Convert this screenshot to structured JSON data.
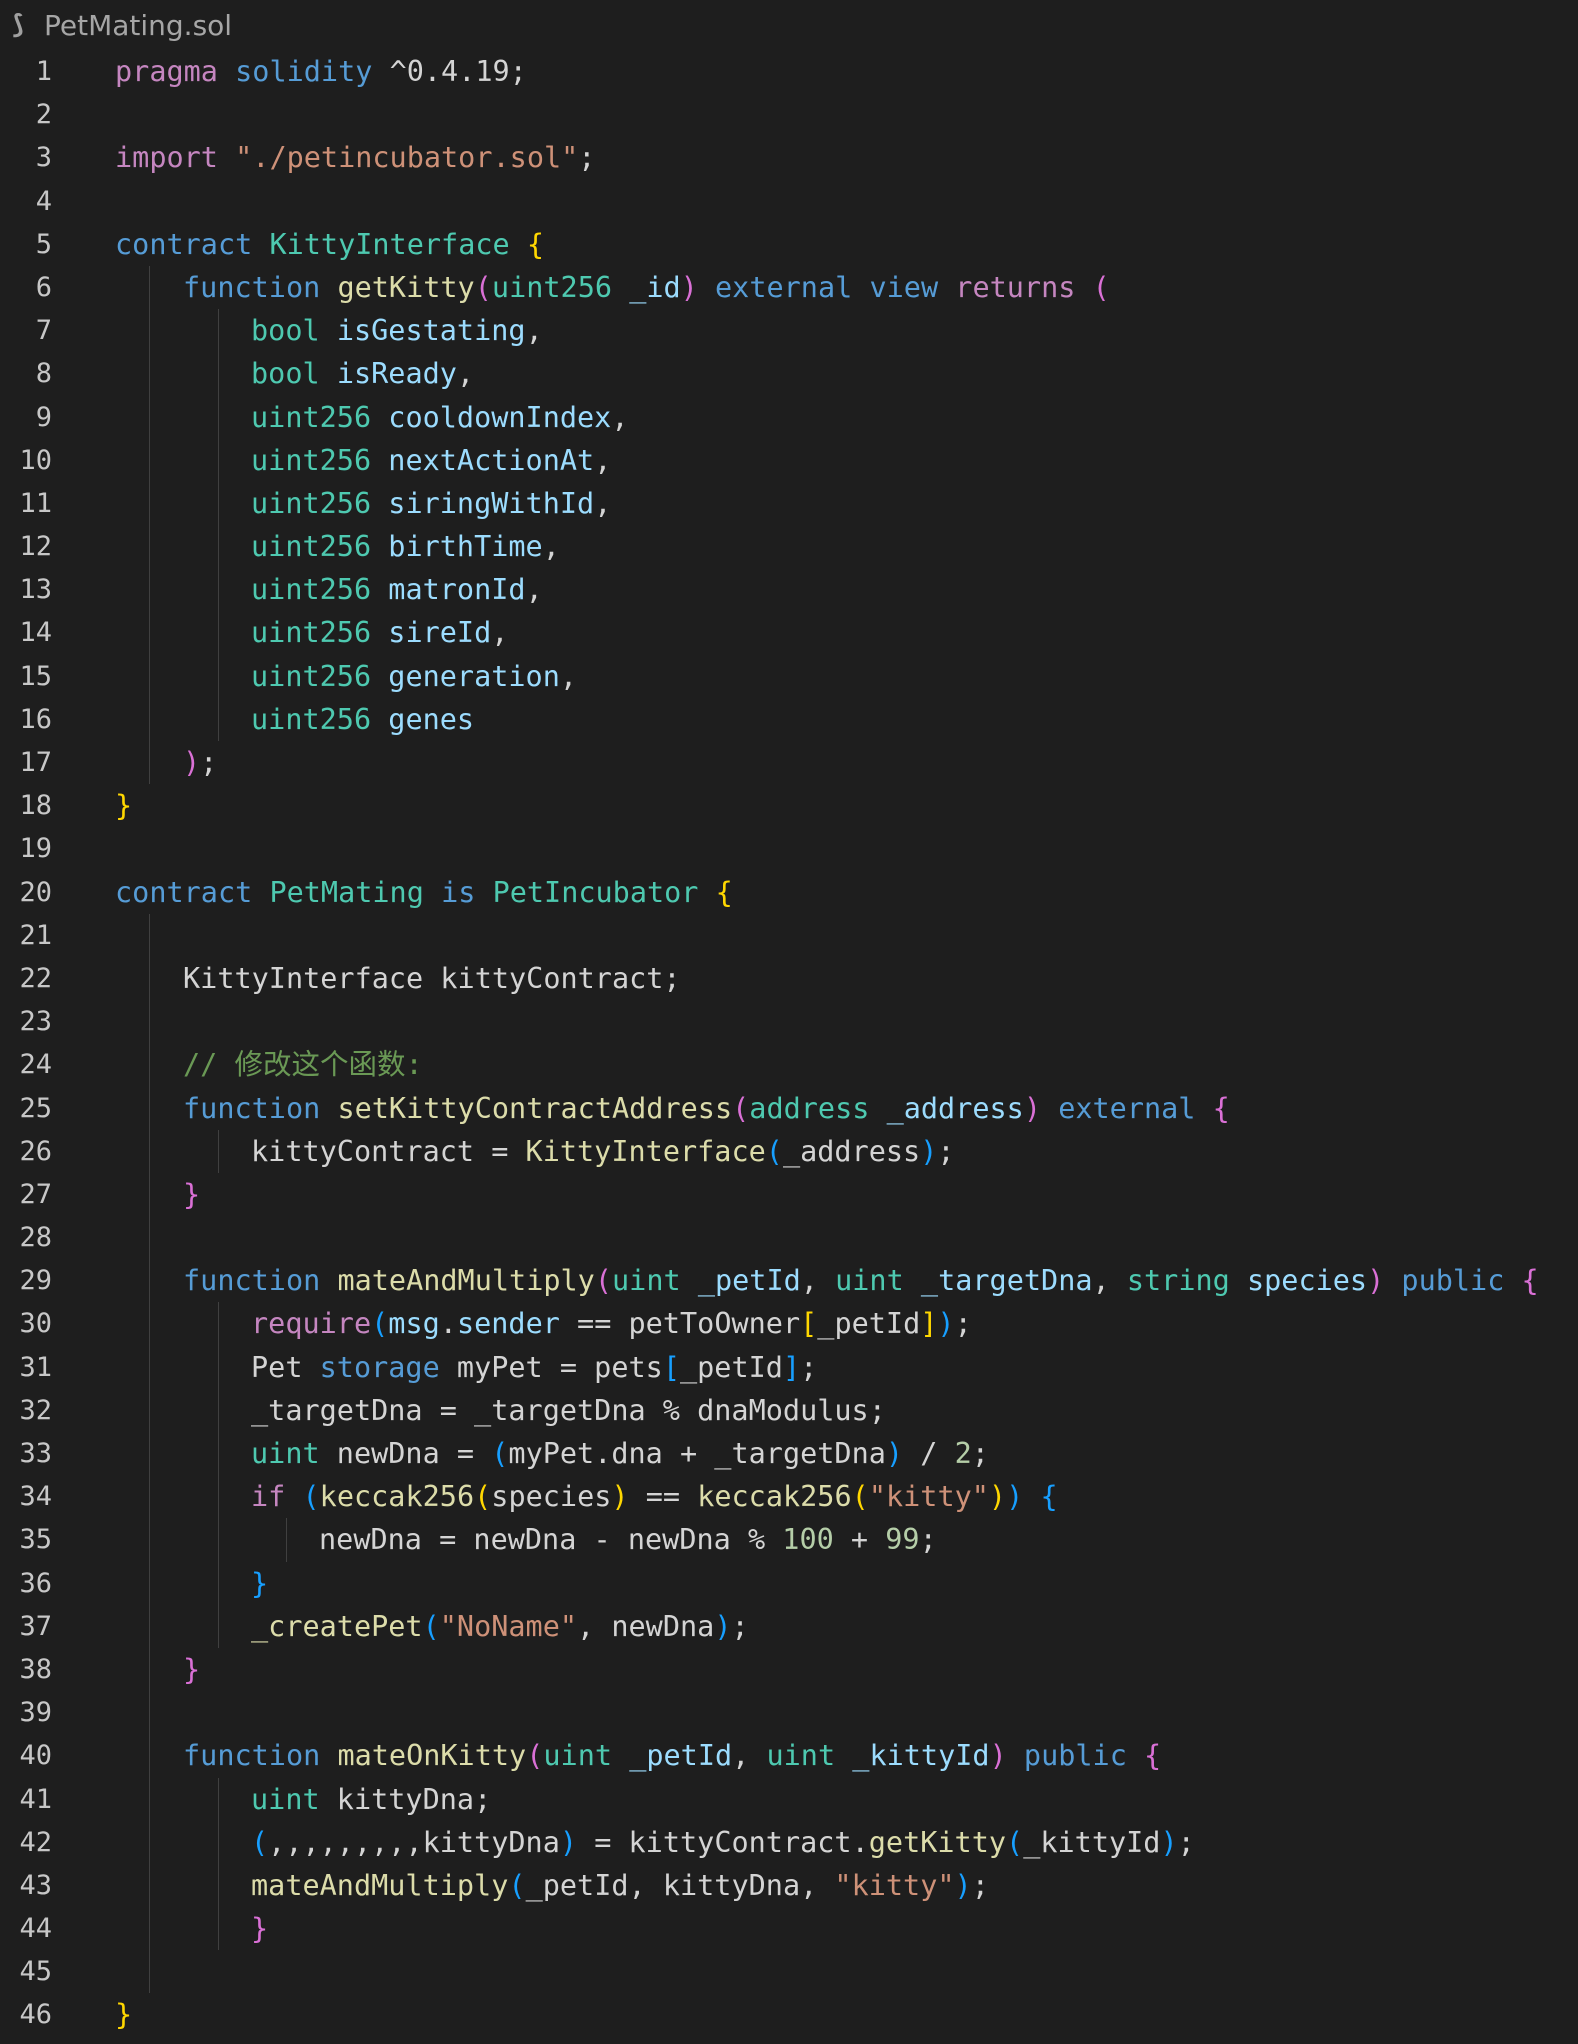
{
  "tab": {
    "title": "PetMating.sol",
    "icon": "solidity-file-icon"
  },
  "lines": [
    {
      "n": "1",
      "indent": 0,
      "tokens": [
        [
          "ctl",
          "pragma"
        ],
        [
          "pl",
          " "
        ],
        [
          "kw",
          "solidity"
        ],
        [
          "pl",
          " ^0.4.19;"
        ]
      ]
    },
    {
      "n": "2",
      "indent": 0,
      "tokens": []
    },
    {
      "n": "3",
      "indent": 0,
      "tokens": [
        [
          "ctl",
          "import"
        ],
        [
          "pl",
          " "
        ],
        [
          "str",
          "\"./petincubator.sol\""
        ],
        [
          "pl",
          ";"
        ]
      ]
    },
    {
      "n": "4",
      "indent": 0,
      "tokens": []
    },
    {
      "n": "5",
      "indent": 0,
      "tokens": [
        [
          "kw",
          "contract"
        ],
        [
          "pl",
          " "
        ],
        [
          "ty",
          "KittyInterface"
        ],
        [
          "pl",
          " "
        ],
        [
          "b1",
          "{"
        ]
      ]
    },
    {
      "n": "6",
      "indent": 1,
      "tokens": [
        [
          "kw",
          "function"
        ],
        [
          "pl",
          " "
        ],
        [
          "fn",
          "getKitty"
        ],
        [
          "b2",
          "("
        ],
        [
          "ty",
          "uint256"
        ],
        [
          "pl",
          " "
        ],
        [
          "var",
          "_id"
        ],
        [
          "b2",
          ")"
        ],
        [
          "pl",
          " "
        ],
        [
          "kw",
          "external"
        ],
        [
          "pl",
          " "
        ],
        [
          "kw",
          "view"
        ],
        [
          "pl",
          " "
        ],
        [
          "ctl",
          "returns"
        ],
        [
          "pl",
          " "
        ],
        [
          "b2",
          "("
        ]
      ]
    },
    {
      "n": "7",
      "indent": 2,
      "tokens": [
        [
          "ty",
          "bool"
        ],
        [
          "pl",
          " "
        ],
        [
          "var",
          "isGestating"
        ],
        [
          "pl",
          ","
        ]
      ]
    },
    {
      "n": "8",
      "indent": 2,
      "tokens": [
        [
          "ty",
          "bool"
        ],
        [
          "pl",
          " "
        ],
        [
          "var",
          "isReady"
        ],
        [
          "pl",
          ","
        ]
      ]
    },
    {
      "n": "9",
      "indent": 2,
      "tokens": [
        [
          "ty",
          "uint256"
        ],
        [
          "pl",
          " "
        ],
        [
          "var",
          "cooldownIndex"
        ],
        [
          "pl",
          ","
        ]
      ]
    },
    {
      "n": "10",
      "indent": 2,
      "tokens": [
        [
          "ty",
          "uint256"
        ],
        [
          "pl",
          " "
        ],
        [
          "var",
          "nextActionAt"
        ],
        [
          "pl",
          ","
        ]
      ]
    },
    {
      "n": "11",
      "indent": 2,
      "tokens": [
        [
          "ty",
          "uint256"
        ],
        [
          "pl",
          " "
        ],
        [
          "var",
          "siringWithId"
        ],
        [
          "pl",
          ","
        ]
      ]
    },
    {
      "n": "12",
      "indent": 2,
      "tokens": [
        [
          "ty",
          "uint256"
        ],
        [
          "pl",
          " "
        ],
        [
          "var",
          "birthTime"
        ],
        [
          "pl",
          ","
        ]
      ]
    },
    {
      "n": "13",
      "indent": 2,
      "tokens": [
        [
          "ty",
          "uint256"
        ],
        [
          "pl",
          " "
        ],
        [
          "var",
          "matronId"
        ],
        [
          "pl",
          ","
        ]
      ]
    },
    {
      "n": "14",
      "indent": 2,
      "tokens": [
        [
          "ty",
          "uint256"
        ],
        [
          "pl",
          " "
        ],
        [
          "var",
          "sireId"
        ],
        [
          "pl",
          ","
        ]
      ]
    },
    {
      "n": "15",
      "indent": 2,
      "tokens": [
        [
          "ty",
          "uint256"
        ],
        [
          "pl",
          " "
        ],
        [
          "var",
          "generation"
        ],
        [
          "pl",
          ","
        ]
      ]
    },
    {
      "n": "16",
      "indent": 2,
      "tokens": [
        [
          "ty",
          "uint256"
        ],
        [
          "pl",
          " "
        ],
        [
          "var",
          "genes"
        ]
      ]
    },
    {
      "n": "17",
      "indent": 1,
      "tokens": [
        [
          "b2",
          ")"
        ],
        [
          "pl",
          ";"
        ]
      ]
    },
    {
      "n": "18",
      "indent": 0,
      "tokens": [
        [
          "b1",
          "}"
        ]
      ]
    },
    {
      "n": "19",
      "indent": 0,
      "tokens": []
    },
    {
      "n": "20",
      "indent": 0,
      "tokens": [
        [
          "kw",
          "contract"
        ],
        [
          "pl",
          " "
        ],
        [
          "ty",
          "PetMating"
        ],
        [
          "pl",
          " "
        ],
        [
          "kw",
          "is"
        ],
        [
          "pl",
          " "
        ],
        [
          "ty",
          "PetIncubator"
        ],
        [
          "pl",
          " "
        ],
        [
          "b1",
          "{"
        ]
      ]
    },
    {
      "n": "21",
      "indent": 1,
      "tokens": []
    },
    {
      "n": "22",
      "indent": 1,
      "tokens": [
        [
          "pl",
          "KittyInterface kittyContract;"
        ]
      ]
    },
    {
      "n": "23",
      "indent": 1,
      "tokens": []
    },
    {
      "n": "24",
      "indent": 1,
      "tokens": [
        [
          "com",
          "// 修改这个函数:"
        ]
      ]
    },
    {
      "n": "25",
      "indent": 1,
      "tokens": [
        [
          "kw",
          "function"
        ],
        [
          "pl",
          " "
        ],
        [
          "fn",
          "setKittyContractAddress"
        ],
        [
          "b2",
          "("
        ],
        [
          "ty",
          "address"
        ],
        [
          "pl",
          " "
        ],
        [
          "var",
          "_address"
        ],
        [
          "b2",
          ")"
        ],
        [
          "pl",
          " "
        ],
        [
          "kw",
          "external"
        ],
        [
          "pl",
          " "
        ],
        [
          "b2",
          "{"
        ]
      ]
    },
    {
      "n": "26",
      "indent": 2,
      "tokens": [
        [
          "pl",
          "kittyContract = "
        ],
        [
          "fn",
          "KittyInterface"
        ],
        [
          "b3",
          "("
        ],
        [
          "pl",
          "_address"
        ],
        [
          "b3",
          ")"
        ],
        [
          "pl",
          ";"
        ]
      ]
    },
    {
      "n": "27",
      "indent": 1,
      "tokens": [
        [
          "b2",
          "}"
        ]
      ]
    },
    {
      "n": "28",
      "indent": 1,
      "tokens": []
    },
    {
      "n": "29",
      "indent": 1,
      "tokens": [
        [
          "kw",
          "function"
        ],
        [
          "pl",
          " "
        ],
        [
          "fn",
          "mateAndMultiply"
        ],
        [
          "b2",
          "("
        ],
        [
          "ty",
          "uint"
        ],
        [
          "pl",
          " "
        ],
        [
          "var",
          "_petId"
        ],
        [
          "pl",
          ", "
        ],
        [
          "ty",
          "uint"
        ],
        [
          "pl",
          " "
        ],
        [
          "var",
          "_targetDna"
        ],
        [
          "pl",
          ", "
        ],
        [
          "ty",
          "string"
        ],
        [
          "pl",
          " "
        ],
        [
          "var",
          "species"
        ],
        [
          "b2",
          ")"
        ],
        [
          "pl",
          " "
        ],
        [
          "kw",
          "public"
        ],
        [
          "pl",
          " "
        ],
        [
          "b2",
          "{"
        ]
      ]
    },
    {
      "n": "30",
      "indent": 2,
      "tokens": [
        [
          "ctl",
          "require"
        ],
        [
          "b3",
          "("
        ],
        [
          "var",
          "msg"
        ],
        [
          "pl",
          "."
        ],
        [
          "var",
          "sender"
        ],
        [
          "pl",
          " == petToOwner"
        ],
        [
          "b1",
          "["
        ],
        [
          "pl",
          "_petId"
        ],
        [
          "b1",
          "]"
        ],
        [
          "b3",
          ")"
        ],
        [
          "pl",
          ";"
        ]
      ]
    },
    {
      "n": "31",
      "indent": 2,
      "tokens": [
        [
          "pl",
          "Pet "
        ],
        [
          "kw",
          "storage"
        ],
        [
          "pl",
          " myPet = pets"
        ],
        [
          "b3",
          "["
        ],
        [
          "pl",
          "_petId"
        ],
        [
          "b3",
          "]"
        ],
        [
          "pl",
          ";"
        ]
      ]
    },
    {
      "n": "32",
      "indent": 2,
      "tokens": [
        [
          "pl",
          "_targetDna = _targetDna % dnaModulus;"
        ]
      ]
    },
    {
      "n": "33",
      "indent": 2,
      "tokens": [
        [
          "ty",
          "uint"
        ],
        [
          "pl",
          " newDna = "
        ],
        [
          "b3",
          "("
        ],
        [
          "pl",
          "myPet.dna + _targetDna"
        ],
        [
          "b3",
          ")"
        ],
        [
          "pl",
          " / "
        ],
        [
          "num",
          "2"
        ],
        [
          "pl",
          ";"
        ]
      ]
    },
    {
      "n": "34",
      "indent": 2,
      "tokens": [
        [
          "ctl",
          "if"
        ],
        [
          "pl",
          " "
        ],
        [
          "b3",
          "("
        ],
        [
          "fn",
          "keccak256"
        ],
        [
          "b1",
          "("
        ],
        [
          "pl",
          "species"
        ],
        [
          "b1",
          ")"
        ],
        [
          "pl",
          " == "
        ],
        [
          "fn",
          "keccak256"
        ],
        [
          "b1",
          "("
        ],
        [
          "str",
          "\"kitty\""
        ],
        [
          "b1",
          ")"
        ],
        [
          "b3",
          ")"
        ],
        [
          "pl",
          " "
        ],
        [
          "b3",
          "{"
        ]
      ]
    },
    {
      "n": "35",
      "indent": 3,
      "tokens": [
        [
          "pl",
          "newDna = newDna - newDna % "
        ],
        [
          "num",
          "100"
        ],
        [
          "pl",
          " + "
        ],
        [
          "num",
          "99"
        ],
        [
          "pl",
          ";"
        ]
      ]
    },
    {
      "n": "36",
      "indent": 2,
      "tokens": [
        [
          "b3",
          "}"
        ]
      ]
    },
    {
      "n": "37",
      "indent": 2,
      "tokens": [
        [
          "fn",
          "_createPet"
        ],
        [
          "b3",
          "("
        ],
        [
          "str",
          "\"NoName\""
        ],
        [
          "pl",
          ", newDna"
        ],
        [
          "b3",
          ")"
        ],
        [
          "pl",
          ";"
        ]
      ]
    },
    {
      "n": "38",
      "indent": 1,
      "tokens": [
        [
          "b2",
          "}"
        ]
      ]
    },
    {
      "n": "39",
      "indent": 1,
      "tokens": []
    },
    {
      "n": "40",
      "indent": 1,
      "tokens": [
        [
          "kw",
          "function"
        ],
        [
          "pl",
          " "
        ],
        [
          "fn",
          "mateOnKitty"
        ],
        [
          "b2",
          "("
        ],
        [
          "ty",
          "uint"
        ],
        [
          "pl",
          " "
        ],
        [
          "var",
          "_petId"
        ],
        [
          "pl",
          ", "
        ],
        [
          "ty",
          "uint"
        ],
        [
          "pl",
          " "
        ],
        [
          "var",
          "_kittyId"
        ],
        [
          "b2",
          ")"
        ],
        [
          "pl",
          " "
        ],
        [
          "kw",
          "public"
        ],
        [
          "pl",
          " "
        ],
        [
          "b2",
          "{"
        ]
      ]
    },
    {
      "n": "41",
      "indent": 2,
      "tokens": [
        [
          "ty",
          "uint"
        ],
        [
          "pl",
          " kittyDna;"
        ]
      ]
    },
    {
      "n": "42",
      "indent": 2,
      "tokens": [
        [
          "b3",
          "("
        ],
        [
          "pl",
          ",,,,,,,,,kittyDna"
        ],
        [
          "b3",
          ")"
        ],
        [
          "pl",
          " = kittyContract."
        ],
        [
          "fn",
          "getKitty"
        ],
        [
          "b3",
          "("
        ],
        [
          "pl",
          "_kittyId"
        ],
        [
          "b3",
          ")"
        ],
        [
          "pl",
          ";"
        ]
      ]
    },
    {
      "n": "43",
      "indent": 2,
      "tokens": [
        [
          "fn",
          "mateAndMultiply"
        ],
        [
          "b3",
          "("
        ],
        [
          "pl",
          "_petId, kittyDna, "
        ],
        [
          "str",
          "\"kitty\""
        ],
        [
          "b3",
          ")"
        ],
        [
          "pl",
          ";"
        ]
      ]
    },
    {
      "n": "44",
      "indent": 2,
      "tokens": [
        [
          "b2",
          "}"
        ]
      ]
    },
    {
      "n": "45",
      "indent": 1,
      "tokens": []
    },
    {
      "n": "46",
      "indent": 0,
      "tokens": [
        [
          "b1",
          "}"
        ]
      ]
    }
  ]
}
